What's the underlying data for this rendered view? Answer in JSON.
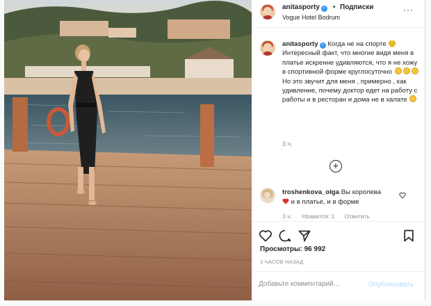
{
  "post": {
    "username": "anitasporty",
    "follow_label": "Подписки",
    "location": "Vogue Hotel Bodrum",
    "caption_text": "Когда не на спорте ☺️ Интересный факт, что многие видя меня в платье искренне удивляются, что я не хожу в спортивной форме круглосуточно",
    "caption_text_2": "Но это звучит для меня , примерно , как удивление, почему доктор едет на работу с работы и в ресторан и дома не в халате",
    "caption_time": "3 ч.",
    "likes_label": "Просмотры: 96 992",
    "time_ago": "3 ЧАСОВ НАЗАД"
  },
  "comment": {
    "username": "troshenkova_olga",
    "text_1": "Вы королева",
    "text_2": "и в платье, и в форме",
    "time": "3 ч.",
    "likes": "Нравится: 1",
    "reply": "Ответить"
  },
  "add_comment": {
    "placeholder": "Добавьте комментарий...",
    "publish_label": "Опубликовать"
  },
  "icons": {
    "verified": "verified-badge-icon",
    "more": "more-options-icon",
    "add": "plus-circle-icon",
    "like": "heart-icon",
    "comment": "comment-icon",
    "share": "paper-plane-icon",
    "save": "bookmark-icon"
  },
  "colors": {
    "verified": "#3897f0",
    "publish": "#b3dbff",
    "muted": "#8e8e8e"
  }
}
